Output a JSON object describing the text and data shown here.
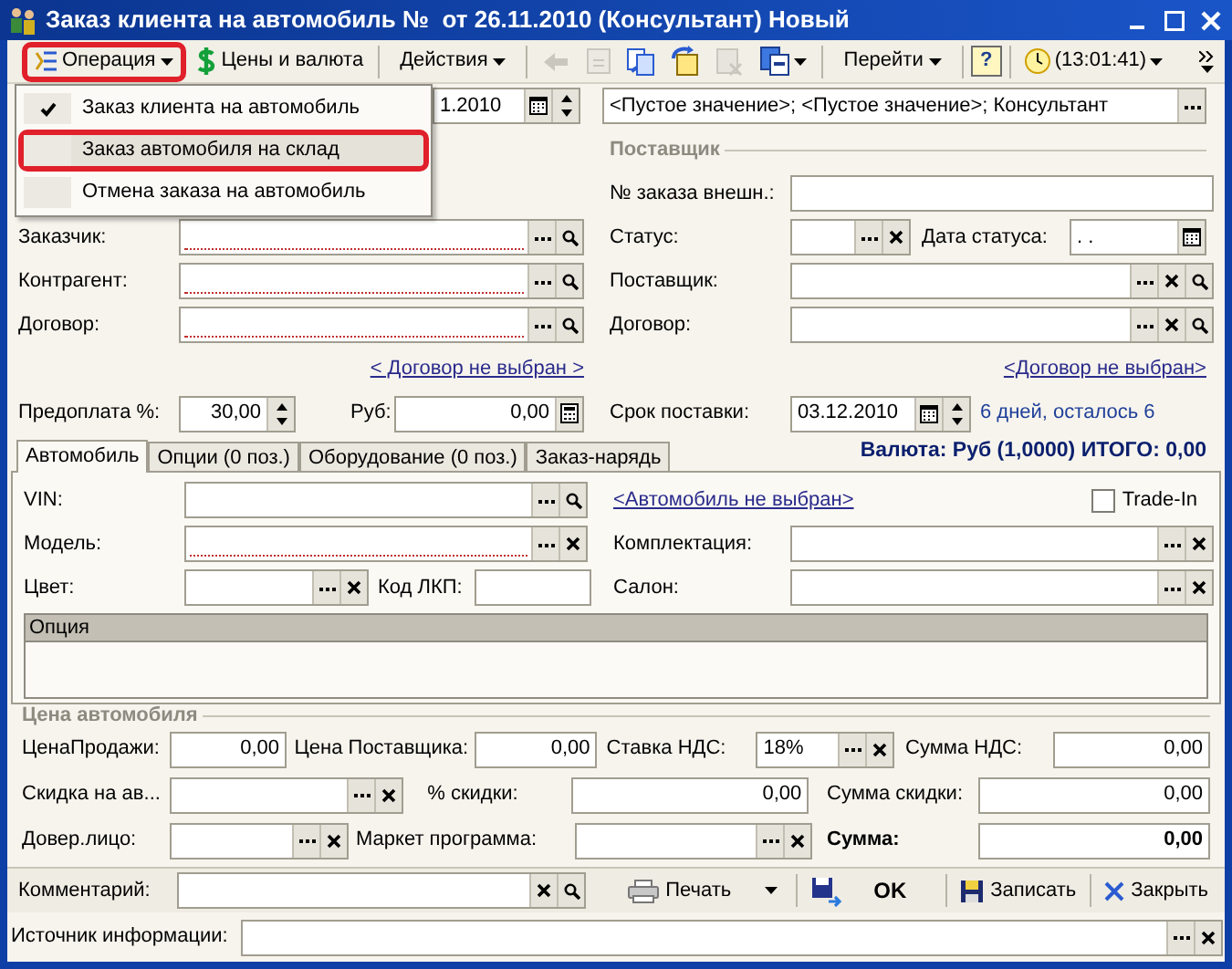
{
  "window": {
    "title": "Заказ клиента на автомобиль №  от 26.11.2010 (Консультант) Новый"
  },
  "toolbar": [
    {
      "kind": "menu",
      "label": "Операция",
      "highlighted": true
    },
    {
      "kind": "button",
      "label": "Цены и валюта"
    },
    {
      "kind": "menu",
      "label": "Действия"
    },
    {
      "kind": "icon",
      "disabled": true
    },
    {
      "kind": "icon",
      "disabled": true
    },
    {
      "kind": "icon",
      "disabled": false
    },
    {
      "kind": "icon",
      "disabled": false
    },
    {
      "kind": "icon",
      "disabled": true
    },
    {
      "kind": "icon-menu",
      "disabled": false
    },
    {
      "kind": "menu",
      "label": "Перейти"
    },
    {
      "kind": "help",
      "label": "?"
    },
    {
      "kind": "clock",
      "label": "(13:01:41)"
    }
  ],
  "operation_menu": [
    {
      "label": "Заказ клиента на автомобиль",
      "checked": true,
      "highlighted": false
    },
    {
      "label": "Заказ автомобиля на склад",
      "checked": false,
      "highlighted": true
    },
    {
      "label": "Отмена заказа на автомобиль",
      "checked": false,
      "highlighted": false
    }
  ],
  "header": {
    "date": {
      "value": "1.2010",
      "buttons": [
        {
          "kind": "calendar"
        },
        {
          "kind": "spin"
        }
      ]
    },
    "responsible": {
      "value": "<Пустое значение>; <Пустое значение>; Консультант",
      "buttons": [
        {
          "kind": "select"
        }
      ]
    },
    "customer": {
      "label": "Заказчик:",
      "required": true,
      "buttons": [
        {
          "kind": "select"
        },
        {
          "kind": "search"
        }
      ]
    },
    "contractor": {
      "label": "Контрагент:",
      "required": true,
      "buttons": [
        {
          "kind": "select"
        },
        {
          "kind": "search"
        }
      ]
    },
    "contract": {
      "label": "Договор:",
      "required": true,
      "buttons": [
        {
          "kind": "select"
        },
        {
          "kind": "search"
        }
      ]
    },
    "contract_link": "< Договор не выбран >",
    "prepay": {
      "label": "Предоплата %:",
      "value": "30,00",
      "kind": "number",
      "buttons": [
        {
          "kind": "spin"
        }
      ]
    },
    "rub": {
      "label": "Руб:",
      "value": "0,00",
      "kind": "number",
      "buttons": [
        {
          "kind": "calc"
        }
      ]
    }
  },
  "supplier": {
    "title": "Поставщик",
    "ext_order": {
      "label": "№ заказа внешн.:"
    },
    "status": {
      "label": "Статус:",
      "buttons": [
        {
          "kind": "select"
        },
        {
          "kind": "clear"
        }
      ]
    },
    "status_date": {
      "label": "Дата статуса:",
      "value": " .  .",
      "buttons": [
        {
          "kind": "calendar"
        }
      ]
    },
    "supplier": {
      "label": "Поставщик:",
      "buttons": [
        {
          "kind": "select"
        },
        {
          "kind": "clear"
        },
        {
          "kind": "search"
        }
      ]
    },
    "contract": {
      "label": "Договор:",
      "buttons": [
        {
          "kind": "select"
        },
        {
          "kind": "clear"
        },
        {
          "kind": "search"
        }
      ]
    },
    "contract_link": "<Договор не выбран>",
    "delivery": {
      "label": "Срок поставки:",
      "value": "03.12.2010",
      "buttons": [
        {
          "kind": "calendar"
        },
        {
          "kind": "spin"
        }
      ]
    },
    "delivery_note": "6 дней, осталось 6"
  },
  "tabs": [
    {
      "label": "Автомобиль",
      "selected": true
    },
    {
      "label": "Опции (0 поз.)",
      "selected": false
    },
    {
      "label": "Оборудование (0 поз.)",
      "selected": false
    },
    {
      "label": "Заказ-нарядь",
      "selected": false
    }
  ],
  "totals": "Валюта: Руб (1,0000) ИТОГО: 0,00",
  "car": {
    "vin": {
      "label": "VIN:",
      "buttons": [
        {
          "kind": "select"
        },
        {
          "kind": "search"
        }
      ]
    },
    "car_link": "<Автомобиль не выбран>",
    "trade_in": {
      "label": "Trade-In",
      "checked": false
    },
    "model": {
      "label": "Модель:",
      "required": true,
      "buttons": [
        {
          "kind": "select"
        },
        {
          "kind": "clear"
        }
      ]
    },
    "equipment": {
      "label": "Комплектация:",
      "buttons": [
        {
          "kind": "select"
        },
        {
          "kind": "clear"
        }
      ]
    },
    "color": {
      "label": "Цвет:",
      "buttons": [
        {
          "kind": "select"
        },
        {
          "kind": "clear"
        }
      ]
    },
    "paint_code": {
      "label": "Код ЛКП:"
    },
    "salon": {
      "label": "Салон:",
      "buttons": [
        {
          "kind": "select"
        },
        {
          "kind": "clear"
        }
      ]
    },
    "table": {
      "columns": [
        "Опция"
      ]
    }
  },
  "price": {
    "title": "Цена автомобиля",
    "sale": {
      "label": "ЦенаПродажи:",
      "value": "0,00",
      "kind": "number"
    },
    "supplier_price": {
      "label": "Цена Поставщика:",
      "value": "0,00",
      "kind": "number"
    },
    "vat_rate": {
      "label": "Ставка НДС:",
      "value": "18%",
      "buttons": [
        {
          "kind": "select"
        },
        {
          "kind": "clear"
        }
      ]
    },
    "vat_sum": {
      "label": "Сумма НДС:",
      "value": "0,00",
      "kind": "number"
    },
    "discount": {
      "label": "Скидка на ав...",
      "buttons": [
        {
          "kind": "select"
        },
        {
          "kind": "clear"
        }
      ]
    },
    "discount_pct": {
      "label": "% скидки:",
      "value": "0,00",
      "kind": "number"
    },
    "discount_sum": {
      "label": "Сумма скидки:",
      "value": "0,00",
      "kind": "number"
    },
    "trustee": {
      "label": "Довер.лицо:",
      "buttons": [
        {
          "kind": "select"
        },
        {
          "kind": "clear"
        }
      ]
    },
    "marketing": {
      "label": "Маркет программа:",
      "buttons": [
        {
          "kind": "select"
        },
        {
          "kind": "clear"
        }
      ]
    },
    "total": {
      "label": "Сумма:",
      "value": "0,00",
      "kind": "number",
      "bold": true
    }
  },
  "comment": {
    "label": "Комментарий:",
    "buttons": [
      {
        "kind": "clear"
      },
      {
        "kind": "search"
      }
    ]
  },
  "actions": [
    {
      "kind": "print",
      "label": "Печать"
    },
    {
      "kind": "ok",
      "label": "OK"
    },
    {
      "kind": "save",
      "label": "Записать"
    },
    {
      "kind": "close",
      "label": "Закрыть"
    }
  ],
  "source": {
    "label": "Источник информации:",
    "buttons": [
      {
        "kind": "select"
      },
      {
        "kind": "clear"
      }
    ]
  }
}
